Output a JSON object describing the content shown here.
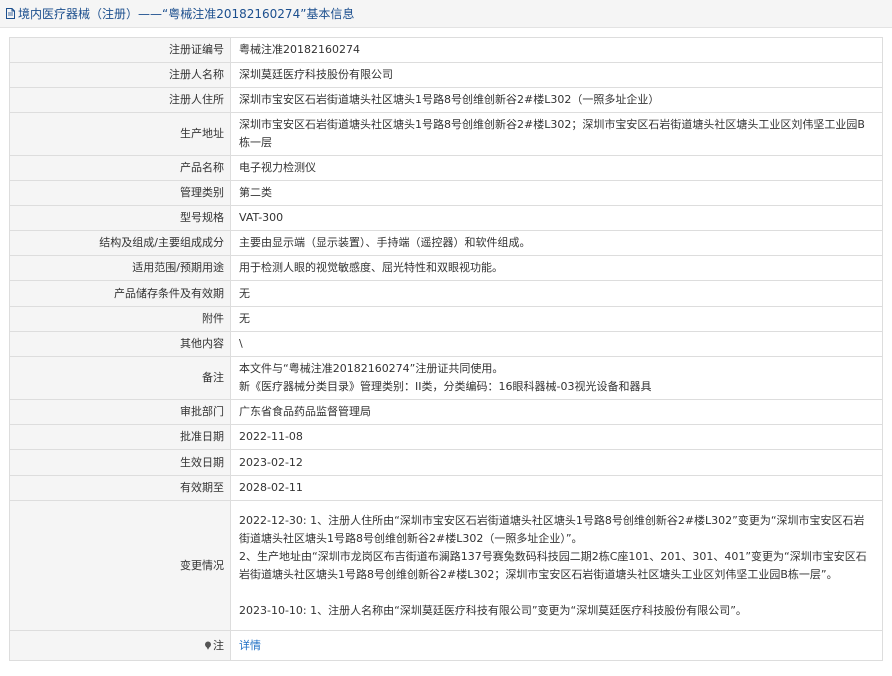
{
  "header": {
    "title": "境内医疗器械（注册）——“粤械注准20182160274”基本信息"
  },
  "rows": [
    {
      "label": "注册证编号",
      "value": "粤械注准20182160274"
    },
    {
      "label": "注册人名称",
      "value": "深圳莫廷医疗科技股份有限公司"
    },
    {
      "label": "注册人住所",
      "value": "深圳市宝安区石岩街道塘头社区塘头1号路8号创维创新谷2#楼L302（一照多址企业）"
    },
    {
      "label": "生产地址",
      "value": "深圳市宝安区石岩街道塘头社区塘头1号路8号创维创新谷2#楼L302；深圳市宝安区石岩街道塘头社区塘头工业区刘伟坚工业园B栋一层"
    },
    {
      "label": "产品名称",
      "value": "电子视力检测仪"
    },
    {
      "label": "管理类别",
      "value": "第二类"
    },
    {
      "label": "型号规格",
      "value": "VAT-300"
    },
    {
      "label": "结构及组成/主要组成成分",
      "value": "主要由显示端（显示装置）、手持端（遥控器）和软件组成。"
    },
    {
      "label": "适用范围/预期用途",
      "value": "用于检测人眼的视觉敏感度、屈光特性和双眼视功能。"
    },
    {
      "label": "产品储存条件及有效期",
      "value": "无"
    },
    {
      "label": "附件",
      "value": "无"
    },
    {
      "label": "其他内容",
      "value": "\\"
    },
    {
      "label": "备注",
      "lines": [
        "本文件与“粤械注准20182160274”注册证共同使用。",
        "新《医疗器械分类目录》管理类别：II类，分类编码：16眼科器械-03视光设备和器具"
      ]
    },
    {
      "label": "审批部门",
      "value": "广东省食品药品监督管理局"
    },
    {
      "label": "批准日期",
      "value": "2022-11-08"
    },
    {
      "label": "生效日期",
      "value": "2023-02-12"
    },
    {
      "label": "有效期至",
      "value": "2028-02-11"
    },
    {
      "label": "变更情况",
      "lines": [
        "2022-12-30: 1、注册人住所由“深圳市宝安区石岩街道塘头社区塘头1号路8号创维创新谷2#楼L302”变更为“深圳市宝安区石岩街道塘头社区塘头1号路8号创维创新谷2#楼L302（一照多址企业）”。",
        "2、生产地址由“深圳市龙岗区布吉街道布澜路137号赛兔数码科技园二期2栋C座101、201、301、401”变更为“深圳市宝安区石岩街道塘头社区塘头1号路8号创维创新谷2#楼L302；深圳市宝安区石岩街道塘头社区塘头工业区刘伟坚工业园B栋一层”。",
        "",
        "2023-10-10: 1、注册人名称由“深圳莫廷医疗科技有限公司”变更为“深圳莫廷医疗科技股份有限公司”。"
      ]
    }
  ],
  "note_row": {
    "label": "注",
    "link_text": "详情"
  },
  "colors": {
    "title_blue": "#1c4f8e",
    "link_blue": "#1c6ec4",
    "label_bg": "#f5f5f5",
    "border": "#dddddd"
  },
  "icons": {
    "title_icon": "document-icon",
    "note_icon": "pin-icon"
  }
}
